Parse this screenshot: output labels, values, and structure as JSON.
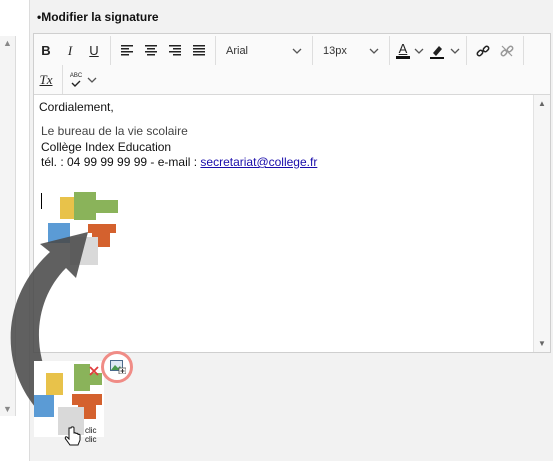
{
  "section_title": "Modifier la signature",
  "toolbar": {
    "bold": "B",
    "italic": "I",
    "underline": "U",
    "font_family": "Arial",
    "font_size": "13px",
    "font_color_letter": "A",
    "clear_format_label": "Tx",
    "spellcheck_label": "ABC"
  },
  "signature": {
    "closing": "Cordialement,",
    "line1": "Le bureau de la vie scolaire",
    "line2": "Collège Index Education",
    "phone_prefix": "tél. : 04 99 99 99 99 - e-mail : ",
    "email": "secretariat@college.fr"
  },
  "click_hint": [
    "clic",
    "clic"
  ],
  "colors": {
    "accent_ring": "#f08c86",
    "link": "#1a0dab",
    "logo_yellow": "#e8c24a",
    "logo_green": "#8ab35a",
    "logo_orange": "#d4612e",
    "logo_blue": "#5b9bd5",
    "logo_gray": "#d9d9d9"
  }
}
